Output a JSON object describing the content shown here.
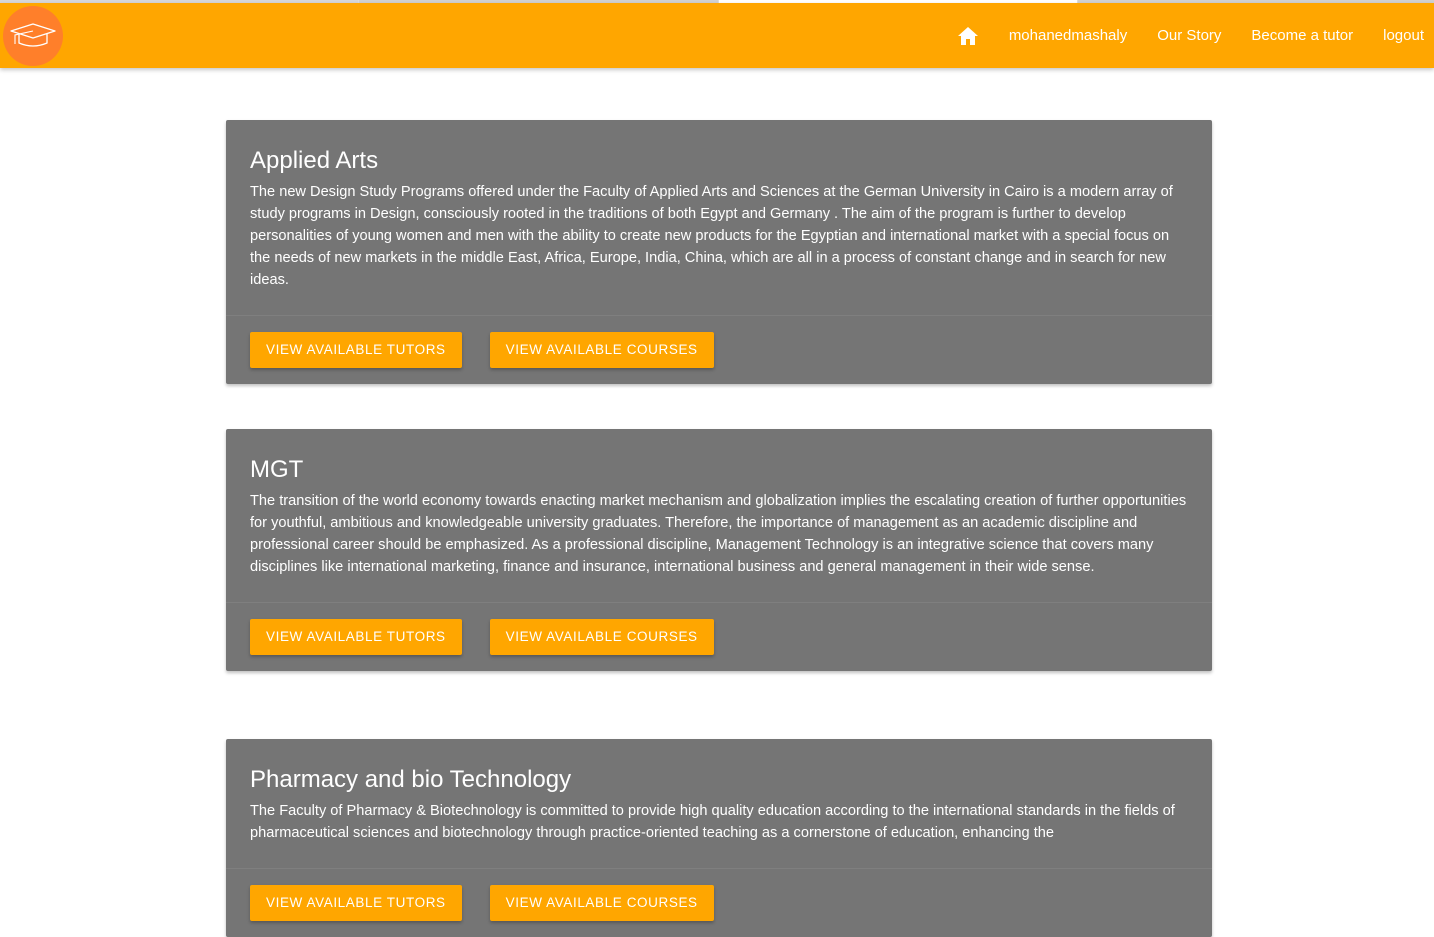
{
  "colors": {
    "navbar": "#ffa600",
    "logo_circle": "#ff7f2a",
    "card_bg": "#757575",
    "button_bg": "#ffa600",
    "text_white": "#ffffff"
  },
  "navbar": {
    "logo_icon": "graduation-cap-icon",
    "home_icon": "home-icon",
    "links": [
      {
        "label": "mohanedmashaly"
      },
      {
        "label": "Our Story"
      },
      {
        "label": "Become a tutor"
      },
      {
        "label": "logout"
      }
    ]
  },
  "faculties": [
    {
      "title": "Applied Arts",
      "description": "The new Design Study Programs offered under the Faculty of Applied Arts and Sciences at the German University in Cairo is a modern array of study programs in Design, consciously rooted in the traditions of both Egypt and Germany . The aim of the program is further to develop personalities of young women and men with the ability to create new products for the Egyptian and international market with a special focus on the needs of new markets in the middle East, Africa, Europe, India, China, which are all in a process of constant change and in search for new ideas.",
      "tutors_label": "VIEW AVAILABLE TUTORS",
      "courses_label": "VIEW AVAILABLE COURSES"
    },
    {
      "title": "MGT",
      "description": "The transition of the world economy towards enacting market mechanism and globalization implies the escalating creation of further opportunities for youthful, ambitious and knowledgeable university graduates. Therefore, the importance of management as an academic discipline and professional career should be emphasized. As a professional discipline, Management Technology is an integrative science that covers many disciplines like international marketing, finance and insurance, international business and general management in their wide sense.",
      "tutors_label": "VIEW AVAILABLE TUTORS",
      "courses_label": "VIEW AVAILABLE COURSES"
    },
    {
      "title": "Pharmacy and bio Technology",
      "description": "The Faculty of Pharmacy & Biotechnology is committed to provide high quality education according to the international standards in the fields of pharmaceutical sciences and biotechnology through practice-oriented teaching as a cornerstone of education, enhancing the",
      "tutors_label": "VIEW AVAILABLE TUTORS",
      "courses_label": "VIEW AVAILABLE COURSES"
    }
  ]
}
